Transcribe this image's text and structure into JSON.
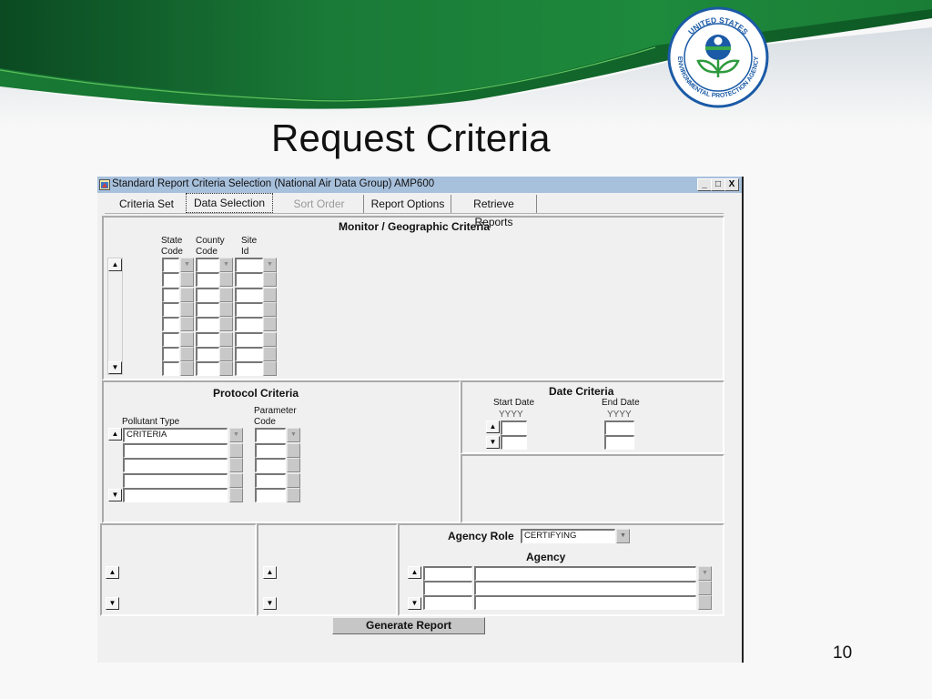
{
  "slide": {
    "title": "Request Criteria",
    "page_number": "10",
    "logo": {
      "top_text": "UNITED STATES",
      "bottom_text": "ENVIRONMENTAL PROTECTION AGENCY",
      "icon": "epa-seal-icon"
    },
    "colors": {
      "banner_dark": "#0d4f26",
      "banner_mid": "#1c863a",
      "logo_blue": "#1a5aa6"
    }
  },
  "window": {
    "title": "Standard Report Criteria Selection (National Air Data Group) AMP600",
    "controls": {
      "minimize": "_",
      "maximize": "□",
      "close": "X"
    },
    "tabs": [
      {
        "label": "Criteria Set",
        "state": "normal"
      },
      {
        "label": "Data Selection",
        "state": "active"
      },
      {
        "label": "Sort Order",
        "state": "disabled"
      },
      {
        "label": "Report Options",
        "state": "normal"
      },
      {
        "label": "Retrieve Reports",
        "state": "normal"
      }
    ]
  },
  "monitor": {
    "heading": "Monitor / Geographic Criteria",
    "columns": [
      {
        "label_line1": "State",
        "label_line2": "Code"
      },
      {
        "label_line1": "County",
        "label_line2": "Code"
      },
      {
        "label_line1": "Site",
        "label_line2": "Id"
      }
    ],
    "row_count": 8,
    "values": [
      "",
      "",
      "",
      "",
      "",
      "",
      "",
      ""
    ]
  },
  "protocol": {
    "heading": "Protocol Criteria",
    "pollutant_label": "Pollutant Type",
    "parameter_label_line1": "Parameter",
    "parameter_label_line2": "Code",
    "pollutant_values": [
      "CRITERIA",
      "",
      "",
      "",
      ""
    ],
    "parameter_values": [
      "",
      "",
      "",
      "",
      ""
    ]
  },
  "date": {
    "heading": "Date Criteria",
    "start_label": "Start Date",
    "end_label": "End Date",
    "start_format": "YYYY",
    "end_format": "YYYY",
    "start_values": [
      "",
      ""
    ],
    "end_values": [
      "",
      ""
    ]
  },
  "agency": {
    "role_label": "Agency Role",
    "role_value": "CERTIFYING",
    "heading": "Agency",
    "rows": [
      {
        "code": "",
        "name": ""
      },
      {
        "code": "",
        "name": ""
      },
      {
        "code": "",
        "name": ""
      }
    ]
  },
  "actions": {
    "generate_label": "Generate Report"
  }
}
